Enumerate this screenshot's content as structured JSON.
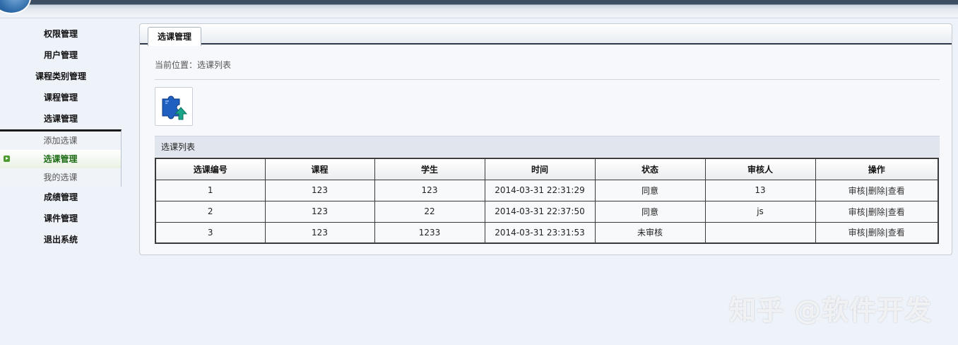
{
  "sidebar": {
    "items_top": [
      "权限管理",
      "用户管理",
      "课程类别管理",
      "课程管理",
      "选课管理"
    ],
    "submenu": [
      "添加选课",
      "选课管理",
      "我的选课"
    ],
    "items_bottom": [
      "成绩管理",
      "课件管理",
      "退出系统"
    ]
  },
  "main": {
    "tab": "选课管理",
    "breadcrumb": "当前位置：选课列表",
    "action_icon": "puzzle-upload-icon",
    "list_title": "选课列表",
    "table": {
      "headers": [
        "选课编号",
        "课程",
        "学生",
        "时间",
        "状态",
        "审核人",
        "操作"
      ],
      "rows": [
        [
          "1",
          "123",
          "123",
          "2014-03-31 22:31:29",
          "同意",
          "13"
        ],
        [
          "2",
          "123",
          "22",
          "2014-03-31 22:37:50",
          "同意",
          "js"
        ],
        [
          "3",
          "123",
          "1233",
          "2014-03-31 23:31:53",
          "未审核",
          ""
        ]
      ],
      "actions": [
        "审核",
        "|",
        "删除",
        "|",
        "查看"
      ]
    }
  },
  "watermark": "知乎 @软件开发"
}
